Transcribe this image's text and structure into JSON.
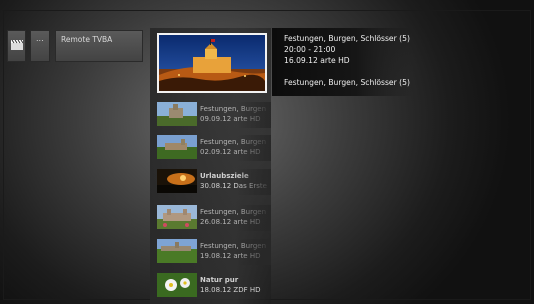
{
  "header_tiles": {
    "clapper_icon": "clapperboard-icon",
    "more_label": "...",
    "remote_label": "Remote TVBA"
  },
  "featured": {
    "title": "Festungen, Burgen, Schlösser (5)",
    "time": "20:00 - 21:00",
    "date_channel": "16.09.12  arte HD",
    "description": "Festungen, Burgen, Schlösser (5)"
  },
  "recordings": [
    {
      "title": "Festungen, Burgen",
      "meta": "09.09.12 arte HD"
    },
    {
      "title": "Festungen, Burgen",
      "meta": "02.09.12 arte HD"
    },
    {
      "title": "Urlaubsziele",
      "meta": "30.08.12 Das Erste"
    },
    {
      "title": "Festungen, Burgen",
      "meta": "26.08.12 arte HD"
    },
    {
      "title": "Festungen, Burgen",
      "meta": "19.08.12 arte HD"
    },
    {
      "title": "Natur pur",
      "meta": "18.08.12 ZDF HD"
    }
  ],
  "colors": {
    "background": "#3c3c3c",
    "selection_border": "#f2f2f2",
    "text": "#f0f0f0"
  }
}
